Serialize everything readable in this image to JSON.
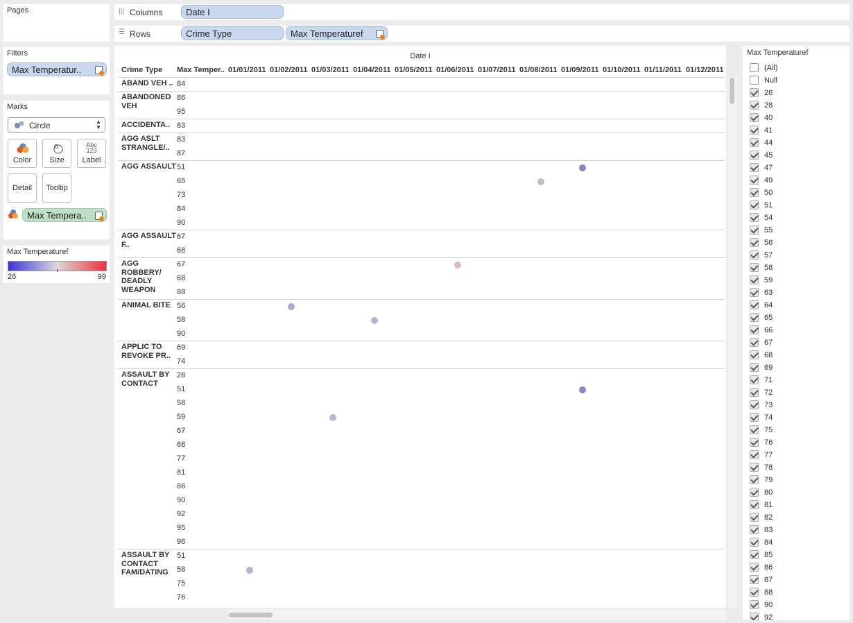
{
  "pages": {
    "title": "Pages"
  },
  "filters": {
    "title": "Filters",
    "pill": "Max Temperatur.."
  },
  "marks": {
    "title": "Marks",
    "type": "Circle",
    "buttons": {
      "color": "Color",
      "size": "Size",
      "label": "Label",
      "detail": "Detail",
      "tooltip": "Tooltip"
    },
    "label_icon": "Abc\n123",
    "color_pill": "Max Tempera.."
  },
  "legend": {
    "title": "Max Temperaturef",
    "min": "26",
    "max": "99",
    "colors": {
      "low": "#3a35d6",
      "mid": "#d9d9d9",
      "high": "#f0303c"
    }
  },
  "shelves": {
    "columns_label": "Columns",
    "rows_label": "Rows",
    "columns_pills": [
      "Date I"
    ],
    "rows_pills": [
      "Crime Type",
      "Max Temperaturef"
    ]
  },
  "view": {
    "top_header": "Date I",
    "row_header_1": "Crime Type",
    "row_header_2": "Max Temper..",
    "dates": [
      "01/01/2011",
      "01/02/2011",
      "01/03/2011",
      "01/04/2011",
      "01/05/2011",
      "01/06/2011",
      "01/07/2011",
      "01/08/2011",
      "01/09/2011",
      "01/10/2011",
      "01/11/2011",
      "01/12/2011"
    ],
    "groups": [
      {
        "crime": "ABAND VEH ..",
        "temps": [
          "84"
        ]
      },
      {
        "crime": "ABANDONED VEH",
        "temps": [
          "86",
          "95"
        ]
      },
      {
        "crime": "ACCIDENTA..",
        "temps": [
          "83"
        ]
      },
      {
        "crime": "AGG ASLT STRANGLE/..",
        "temps": [
          "83",
          "87"
        ]
      },
      {
        "crime": "AGG ASSAULT",
        "temps": [
          "51",
          "65",
          "73",
          "84",
          "90"
        ]
      },
      {
        "crime": "AGG ASSAULT F..",
        "temps": [
          "67",
          "68"
        ]
      },
      {
        "crime": "AGG ROBBERY/ DEADLY WEAPON",
        "temps": [
          "67",
          "68",
          "88"
        ]
      },
      {
        "crime": "ANIMAL BITE",
        "temps": [
          "56",
          "58",
          "90"
        ]
      },
      {
        "crime": "APPLIC TO REVOKE PR..",
        "temps": [
          "69",
          "74"
        ]
      },
      {
        "crime": "ASSAULT BY CONTACT",
        "temps": [
          "28",
          "51",
          "58",
          "59",
          "67",
          "68",
          "77",
          "81",
          "86",
          "90",
          "92",
          "95",
          "96"
        ]
      },
      {
        "crime": "ASSAULT BY CONTACT FAM/DATING",
        "temps": [
          "51",
          "58",
          "75",
          "76"
        ]
      }
    ],
    "points": [
      {
        "crime": "AGG ASSAULT",
        "temp": "51",
        "date": "01/09/2011",
        "color": "#8888cc"
      },
      {
        "crime": "AGG ASSAULT",
        "temp": "65",
        "date": "01/08/2011",
        "color": "#c7b9c3"
      },
      {
        "crime": "AGG ROBBERY/ DEADLY WEAPON",
        "temp": "67",
        "date": "01/06/2011",
        "color": "#d6bcc0"
      },
      {
        "crime": "ANIMAL BITE",
        "temp": "56",
        "date": "01/02/2011",
        "color": "#a8a8d2"
      },
      {
        "crime": "ANIMAL BITE",
        "temp": "58",
        "date": "01/04/2011",
        "color": "#b2b2d4"
      },
      {
        "crime": "ASSAULT BY CONTACT",
        "temp": "51",
        "date": "01/09/2011",
        "color": "#8888cc"
      },
      {
        "crime": "ASSAULT BY CONTACT",
        "temp": "59",
        "date": "01/03/2011",
        "color": "#b8b8d4"
      },
      {
        "crime": "ASSAULT BY CONTACT FAM/DATING",
        "temp": "58",
        "date": "01/01/2011",
        "color": "#b2b2d4"
      }
    ]
  },
  "filter_panel": {
    "title": "Max Temperaturef",
    "items": [
      {
        "label": "(All)",
        "checked": false
      },
      {
        "label": "Null",
        "checked": false
      },
      {
        "label": "26",
        "checked": true
      },
      {
        "label": "28",
        "checked": true
      },
      {
        "label": "40",
        "checked": true
      },
      {
        "label": "41",
        "checked": true
      },
      {
        "label": "44",
        "checked": true
      },
      {
        "label": "45",
        "checked": true
      },
      {
        "label": "47",
        "checked": true
      },
      {
        "label": "49",
        "checked": true
      },
      {
        "label": "50",
        "checked": true
      },
      {
        "label": "51",
        "checked": true
      },
      {
        "label": "54",
        "checked": true
      },
      {
        "label": "55",
        "checked": true
      },
      {
        "label": "56",
        "checked": true
      },
      {
        "label": "57",
        "checked": true
      },
      {
        "label": "58",
        "checked": true
      },
      {
        "label": "59",
        "checked": true
      },
      {
        "label": "63",
        "checked": true
      },
      {
        "label": "64",
        "checked": true
      },
      {
        "label": "65",
        "checked": true
      },
      {
        "label": "66",
        "checked": true
      },
      {
        "label": "67",
        "checked": true
      },
      {
        "label": "68",
        "checked": true
      },
      {
        "label": "69",
        "checked": true
      },
      {
        "label": "71",
        "checked": true
      },
      {
        "label": "72",
        "checked": true
      },
      {
        "label": "73",
        "checked": true
      },
      {
        "label": "74",
        "checked": true
      },
      {
        "label": "75",
        "checked": true
      },
      {
        "label": "76",
        "checked": true
      },
      {
        "label": "77",
        "checked": true
      },
      {
        "label": "78",
        "checked": true
      },
      {
        "label": "79",
        "checked": true
      },
      {
        "label": "80",
        "checked": true
      },
      {
        "label": "81",
        "checked": true
      },
      {
        "label": "82",
        "checked": true
      },
      {
        "label": "83",
        "checked": true
      },
      {
        "label": "84",
        "checked": true
      },
      {
        "label": "85",
        "checked": true
      },
      {
        "label": "86",
        "checked": true
      },
      {
        "label": "87",
        "checked": true
      },
      {
        "label": "88",
        "checked": true
      },
      {
        "label": "90",
        "checked": true
      },
      {
        "label": "92",
        "checked": true
      }
    ]
  }
}
